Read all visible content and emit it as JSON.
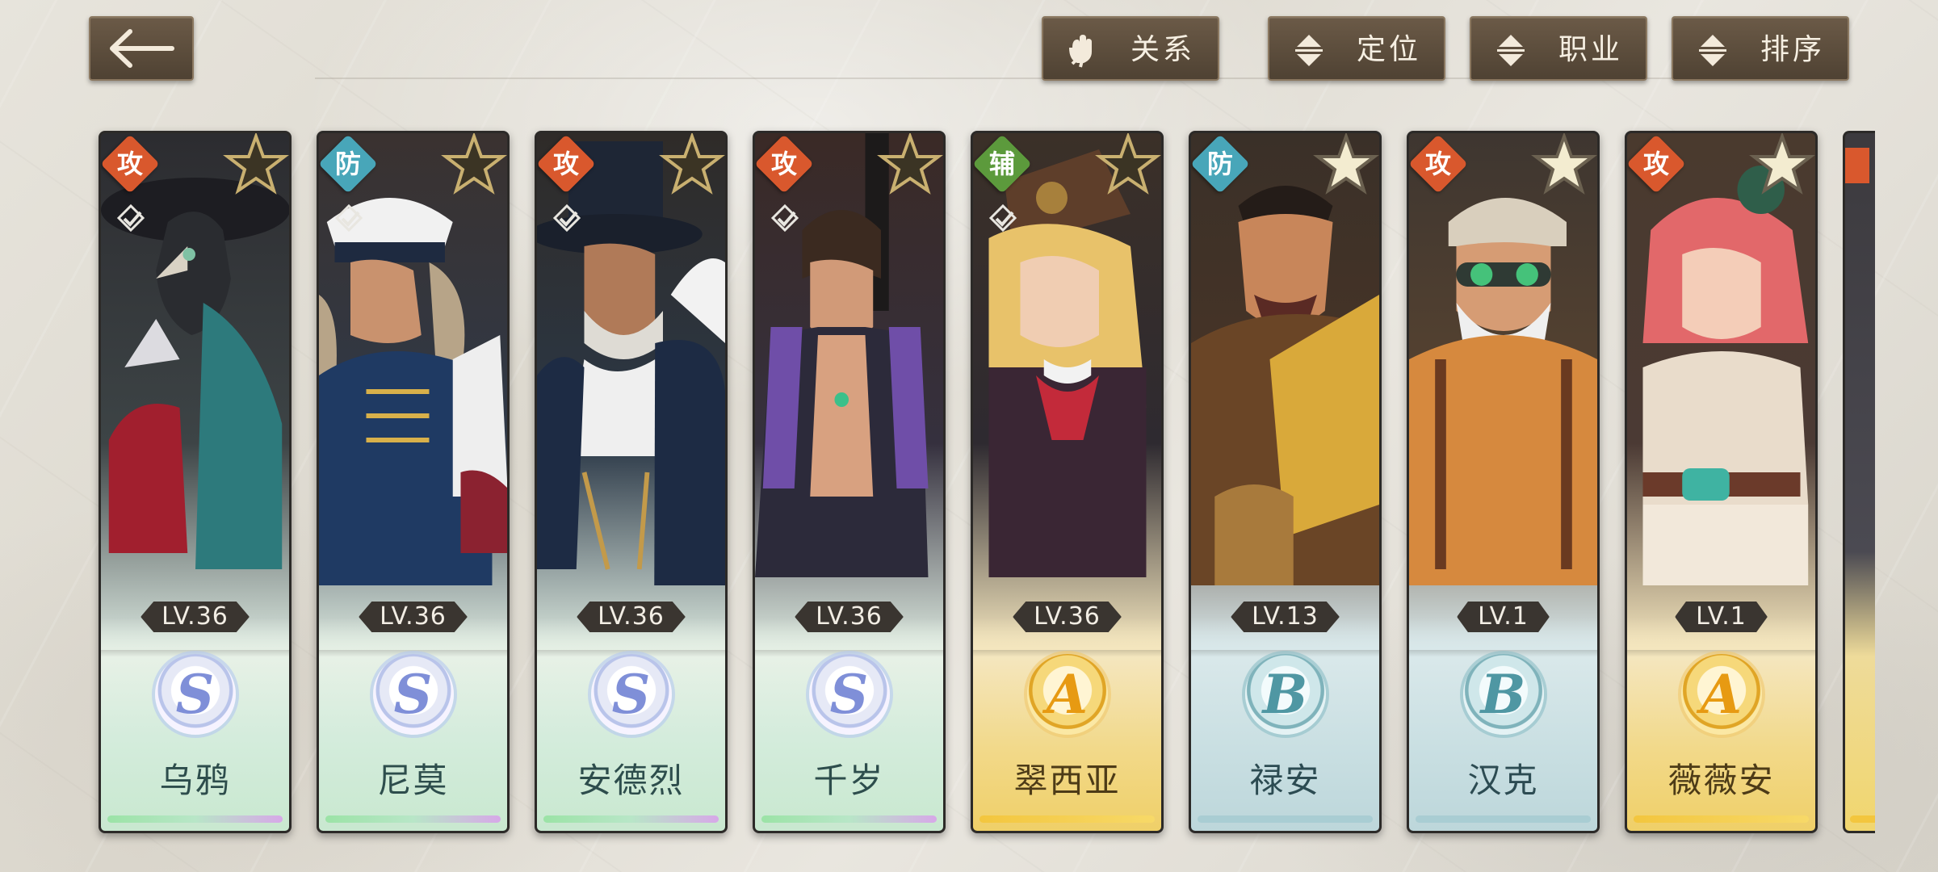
{
  "header": {
    "back_icon": "arrow-left-icon",
    "buttons": [
      {
        "id": "relation",
        "label": "关系",
        "icon": "gloves-icon"
      },
      {
        "id": "position",
        "label": "定位",
        "icon": "sort-arrows-icon"
      },
      {
        "id": "career",
        "label": "职业",
        "icon": "sort-arrows-icon"
      },
      {
        "id": "sort",
        "label": "排序",
        "icon": "sort-arrows-icon"
      }
    ]
  },
  "cards": [
    {
      "name": "乌鸦",
      "level": "LV.36",
      "rank": "S",
      "role": "攻"
    },
    {
      "name": "尼莫",
      "level": "LV.36",
      "rank": "S",
      "role": "防"
    },
    {
      "name": "安德烈",
      "level": "LV.36",
      "rank": "S",
      "role": "攻"
    },
    {
      "name": "千岁",
      "level": "LV.36",
      "rank": "S",
      "role": "攻"
    },
    {
      "name": "翠西亚",
      "level": "LV.36",
      "rank": "A",
      "role": "辅"
    },
    {
      "name": "禄安",
      "level": "LV.13",
      "rank": "B",
      "role": "防"
    },
    {
      "name": "汉克",
      "level": "LV.1",
      "rank": "B",
      "role": "攻"
    },
    {
      "name": "薇薇安",
      "level": "LV.1",
      "rank": "A",
      "role": "攻"
    }
  ],
  "colors": {
    "attack": "#d9582d",
    "defense": "#48a6b9",
    "support": "#5c9a3c",
    "rank_S": "#7f8fd8",
    "rank_A": "#e79a12",
    "rank_B": "#4f97a3",
    "button_bg": "#5c4d3c"
  }
}
